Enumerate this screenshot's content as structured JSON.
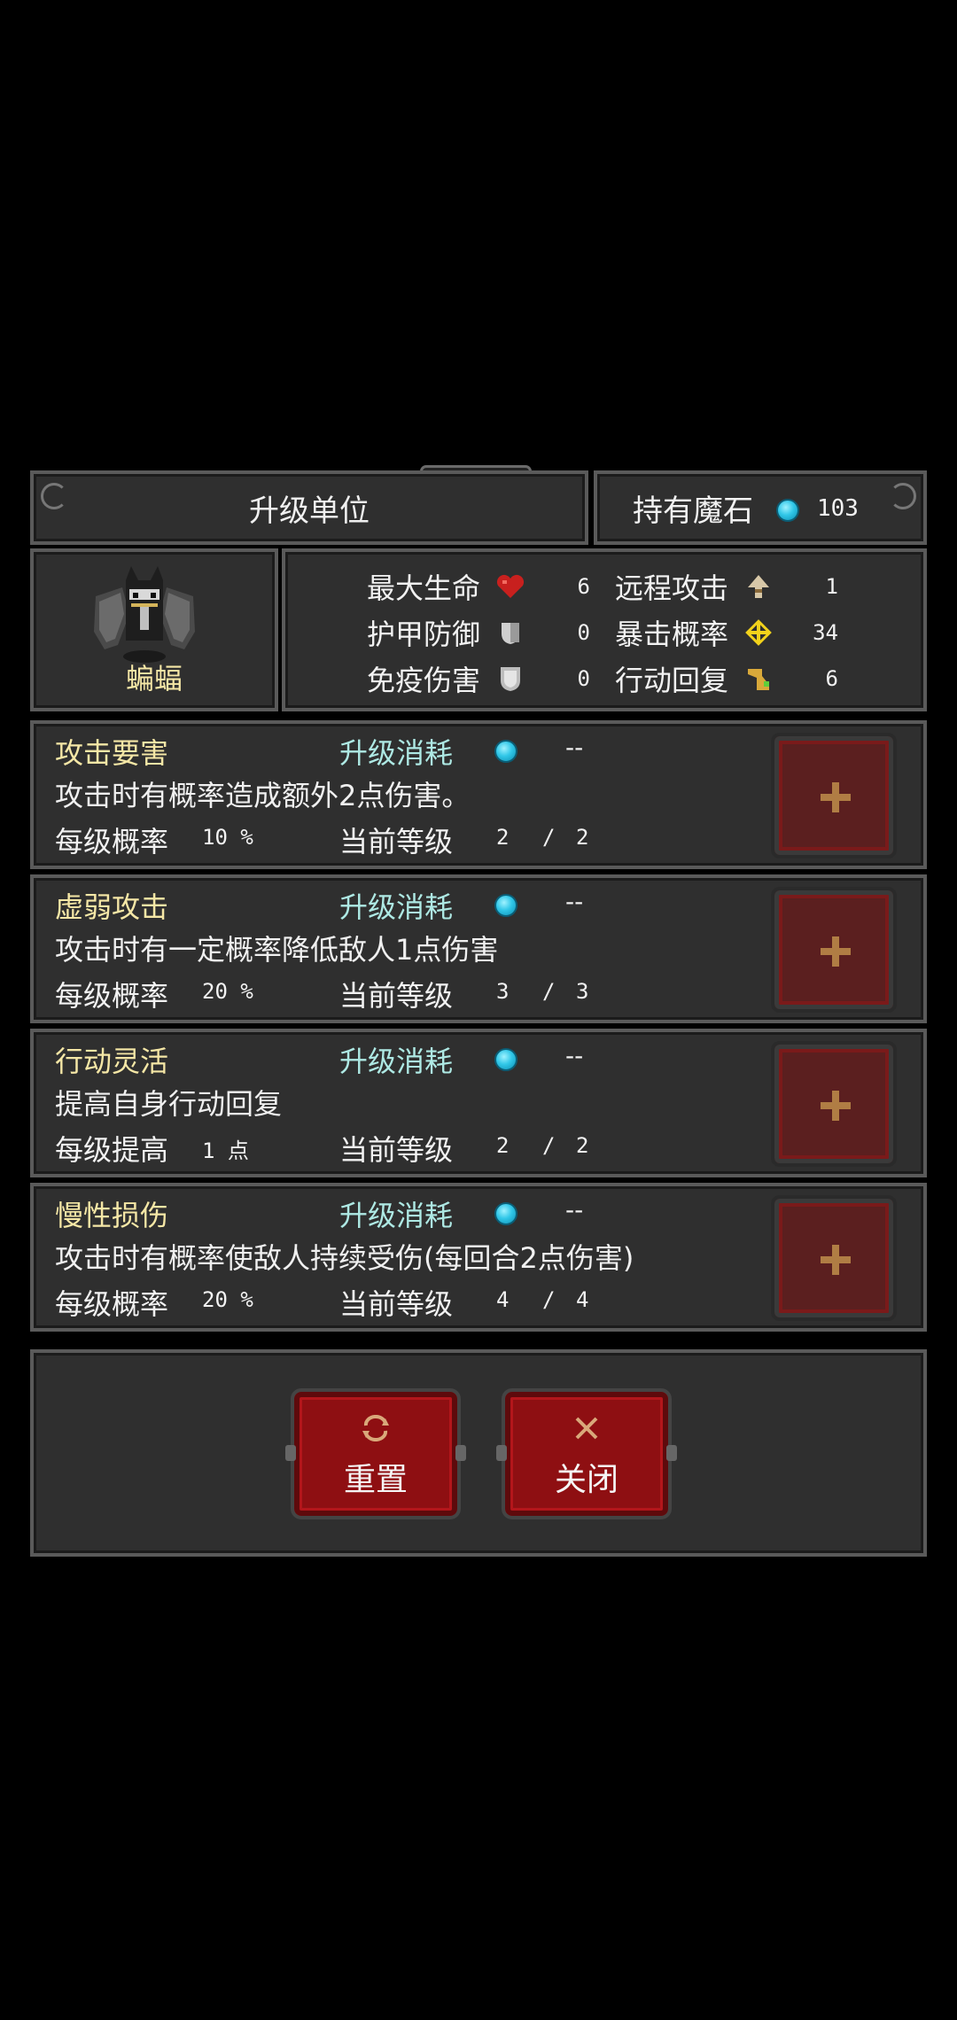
{
  "header": {
    "title": "升级单位",
    "stone_label": "持有魔石",
    "stone_count": "103"
  },
  "unit": {
    "name": "蝙蝠"
  },
  "stats": [
    {
      "label": "最大生命",
      "icon": "heart-icon",
      "value": "6"
    },
    {
      "label": "护甲防御",
      "icon": "armor-icon",
      "value": "0"
    },
    {
      "label": "免疫伤害",
      "icon": "shield-icon",
      "value": "0"
    },
    {
      "label": "远程攻击",
      "icon": "arrow-icon",
      "value": "1"
    },
    {
      "label": "暴击概率",
      "icon": "sparkle-icon",
      "value": "34"
    },
    {
      "label": "行动回复",
      "icon": "boot-icon",
      "value": "6"
    }
  ],
  "skills": [
    {
      "name": "攻击要害",
      "cost_label": "升级消耗",
      "cost": "--",
      "description": "攻击时有概率造成额外2点伤害。",
      "rate_label": "每级概率",
      "rate": "10 %",
      "level_label": "当前等级",
      "level_current": "2",
      "level_sep": "/",
      "level_max": "2"
    },
    {
      "name": "虚弱攻击",
      "cost_label": "升级消耗",
      "cost": "--",
      "description": "攻击时有一定概率降低敌人1点伤害",
      "rate_label": "每级概率",
      "rate": "20 %",
      "level_label": "当前等级",
      "level_current": "3",
      "level_sep": "/",
      "level_max": "3"
    },
    {
      "name": "行动灵活",
      "cost_label": "升级消耗",
      "cost": "--",
      "description": "提高自身行动回复",
      "rate_label": "每级提高",
      "rate": "1 点",
      "level_label": "当前等级",
      "level_current": "2",
      "level_sep": "/",
      "level_max": "2"
    },
    {
      "name": "慢性损伤",
      "cost_label": "升级消耗",
      "cost": "--",
      "description": "攻击时有概率使敌人持续受伤(每回合2点伤害)",
      "rate_label": "每级概率",
      "rate": "20 %",
      "level_label": "当前等级",
      "level_current": "4",
      "level_sep": "/",
      "level_max": "4"
    }
  ],
  "buttons": {
    "reset_label": "重置",
    "close_label": "关闭"
  },
  "colors": {
    "accent_red": "#8e0f12",
    "gem_cyan": "#31c7e8",
    "name_yellow": "#f5e7a6",
    "cost_teal": "#aee9e4"
  }
}
